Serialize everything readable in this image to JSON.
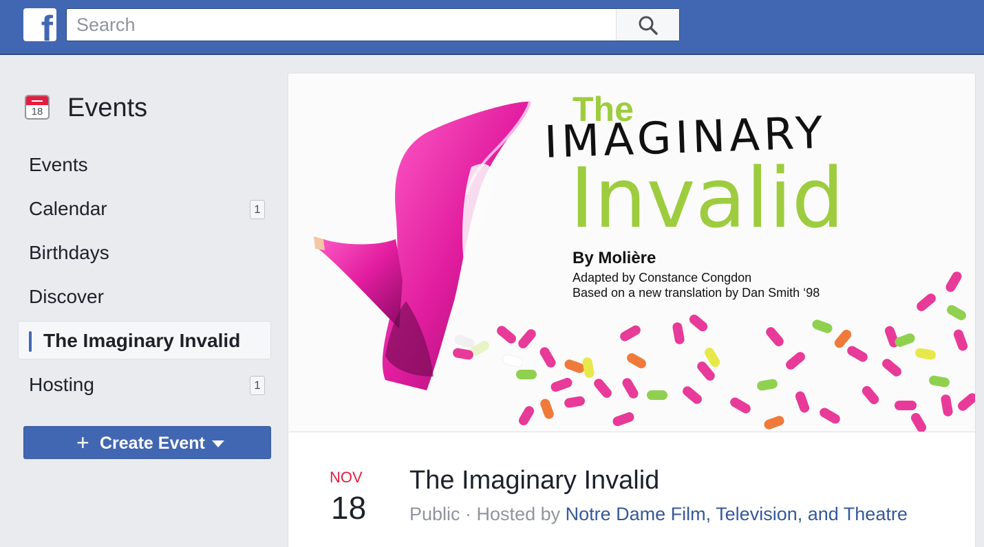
{
  "topbar": {
    "logo_letter": "f",
    "search": {
      "placeholder": "Search",
      "value": ""
    }
  },
  "sidebar": {
    "header_title": "Events",
    "header_icon_day": "18",
    "items": [
      {
        "label": "Events",
        "badge": null
      },
      {
        "label": "Calendar",
        "badge": "1"
      },
      {
        "label": "Birthdays",
        "badge": null
      },
      {
        "label": "Discover",
        "badge": null
      },
      {
        "label": "The Imaginary Invalid",
        "badge": null,
        "active": true
      },
      {
        "label": "Hosting",
        "badge": "1"
      }
    ],
    "create_button": {
      "icon": "plus-icon",
      "label": "Create Event"
    }
  },
  "event": {
    "cover": {
      "title_the": "The",
      "title_imaginary": "IMAGINARY",
      "title_invalid": "Invalid",
      "by_line": "By Molière",
      "adapted_line": "Adapted by Constance Congdon",
      "based_line": "Based on a new translation by Dan Smith ‘98"
    },
    "date": {
      "month": "NOV",
      "day": "18"
    },
    "title": "The Imaginary Invalid",
    "privacy": "Public",
    "separator": " · ",
    "hosted_by_prefix": "Hosted by ",
    "host": "Notre Dame Film, Television, and Theatre"
  },
  "colors": {
    "brand": "#4267b2",
    "title_green": "#9dcd3e",
    "shoe_pink": "#e21d9f",
    "date_red": "#e41e3f",
    "link": "#365899"
  }
}
